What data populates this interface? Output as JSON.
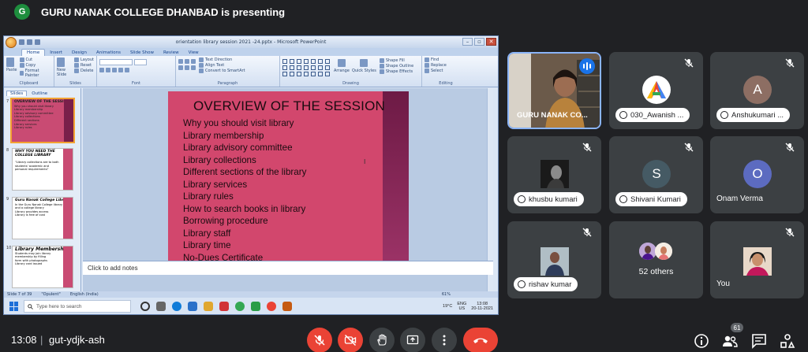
{
  "presenting": {
    "avatar_letter": "G",
    "text": "GURU NANAK COLLEGE DHANBAD is presenting"
  },
  "ppt": {
    "window_title": "orientation library session 2021 -24.pptx - Microsoft PowerPoint",
    "ribbon_tabs": [
      "Home",
      "Insert",
      "Design",
      "Animations",
      "Slide Show",
      "Review",
      "View"
    ],
    "groups": {
      "clipboard": "Clipboard",
      "slides": "Slides",
      "font": "Font",
      "paragraph": "Paragraph",
      "drawing": "Drawing",
      "editing": "Editing"
    },
    "clipboard_items": [
      "Cut",
      "Copy",
      "Format Painter"
    ],
    "paste_label": "Paste",
    "slides_items": [
      "Layout",
      "Reset",
      "Delete"
    ],
    "new_slide_label": "New Slide",
    "paragraph_items": [
      "Text Direction",
      "Align Text",
      "Convert to SmartArt"
    ],
    "drawing_items": [
      "Arrange",
      "Quick Styles"
    ],
    "shape_items": [
      "Shape Fill",
      "Shape Outline",
      "Shape Effects"
    ],
    "editing_items": [
      "Find",
      "Replace",
      "Select"
    ],
    "pane_tabs": [
      "Slides",
      "Outline"
    ],
    "thumbnails": [
      {
        "num": "7",
        "title": "OVERVIEW OF THE SESSION",
        "lines": [
          "Why you should visit library",
          "Library membership",
          "Library advisory committee",
          "Library collections",
          "Different sections",
          "Library services",
          "Library rules"
        ]
      },
      {
        "num": "8",
        "title": "WHY YOU NEED THE COLLEGE LIBRARY",
        "lines": [
          "\"Library collections are to both",
          "students' academic and",
          "personal requirements\""
        ]
      },
      {
        "num": "9",
        "title": "Guru Nanak College Library",
        "lines": [
          "In the Guru Nanak College library",
          "and a college library",
          "Library provides access",
          "Library is free of cost"
        ]
      },
      {
        "num": "10",
        "title": "Library Membership",
        "lines": [
          "Students may join library",
          "membership by filling",
          "form with photographs",
          "Library card issued"
        ]
      }
    ],
    "slide": {
      "title": "OVERVIEW OF THE SESSION",
      "bullets": [
        "Why you should visit library",
        "Library membership",
        "Library advisory committee",
        "Library collections",
        "Different sections of the library",
        "Library services",
        "Library rules",
        "How to search books in library",
        "Borrowing procedure",
        "Library staff",
        "Library time",
        "No-Dues Certificate"
      ]
    },
    "notes_placeholder": "Click to add notes",
    "status": {
      "slide_of": "Slide 7 of 39",
      "theme": "\"Opulent\"",
      "language": "English (India)",
      "zoom": "61%"
    },
    "taskbar": {
      "search_placeholder": "Type here to search",
      "temperature": "19°C",
      "lang1": "ENG",
      "lang2": "US",
      "time": "13:08",
      "date": "20-11-2021"
    }
  },
  "participants": [
    {
      "name": "GURU NANAK CO...",
      "type": "camera",
      "speaking": true
    },
    {
      "name": "030_Awanish ...",
      "type": "avatar",
      "letter": "",
      "color": "#ffffff",
      "muted": true
    },
    {
      "name": "Anshukumari ...",
      "type": "avatar",
      "letter": "A",
      "color": "#8d6e63",
      "muted": true
    },
    {
      "name": "khusbu kumari",
      "type": "photo",
      "muted": true
    },
    {
      "name": "Shivani Kumari",
      "type": "avatar",
      "letter": "S",
      "color": "#455a64",
      "muted": true
    },
    {
      "name": "Onam Verma",
      "type": "avatar",
      "letter": "O",
      "color": "#5c6bc0",
      "muted": true
    },
    {
      "name": "rishav kumar",
      "type": "photo",
      "muted": true
    },
    {
      "name": "52 others",
      "type": "others"
    },
    {
      "name": "You",
      "type": "photo",
      "muted": true
    }
  ],
  "meeting": {
    "time": "13:08",
    "separator": "|",
    "code": "gut-ydjk-ash",
    "participant_count": "61"
  },
  "colors": {
    "mic_off_red": "#ea4335",
    "tile_bg": "#3c4043",
    "active_border": "#8ab4f8",
    "slide_bg": "#d2476d"
  }
}
